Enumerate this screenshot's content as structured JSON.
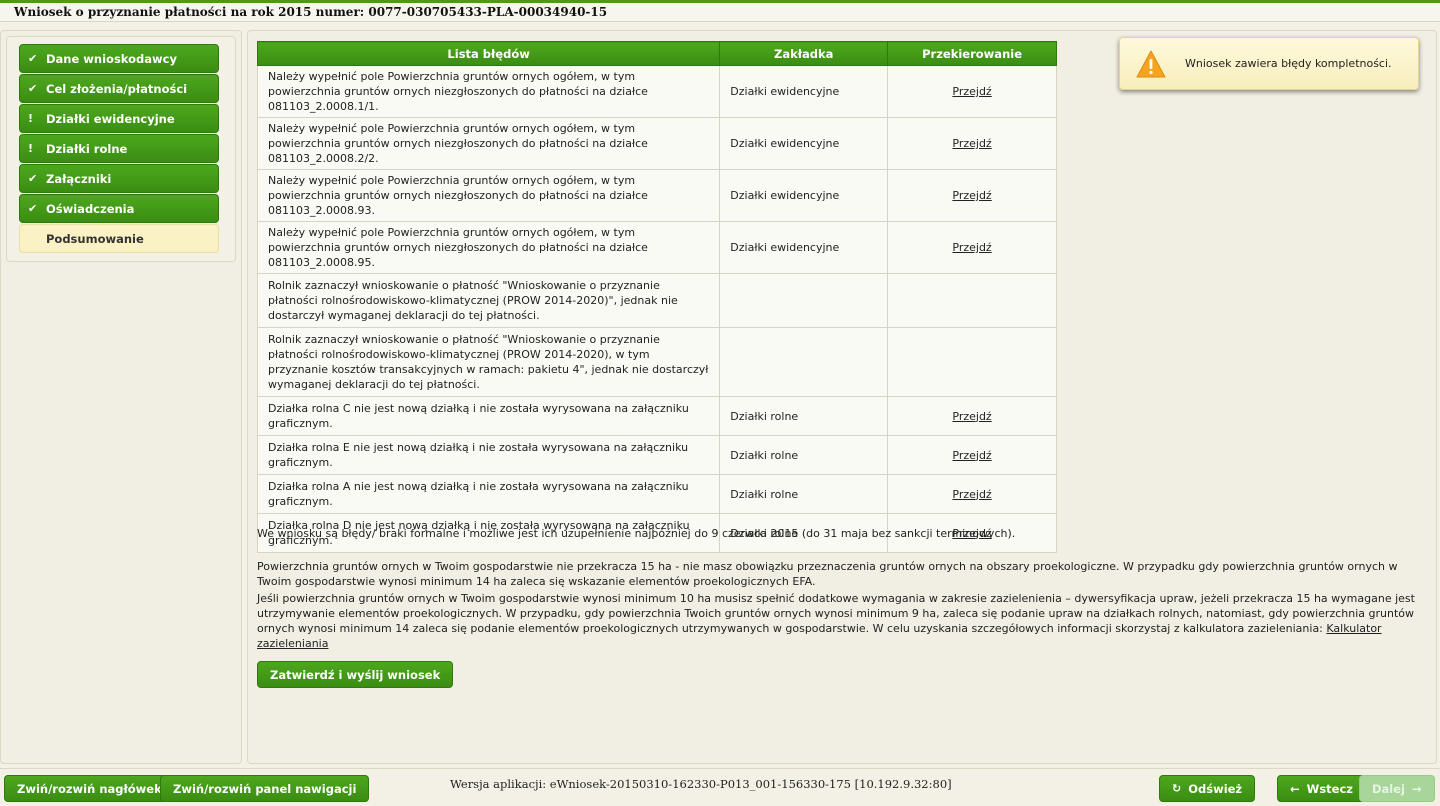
{
  "header": {
    "title": "Wniosek o przyznanie płatności na rok 2015 numer: 0077-030705433-PLA-00034940-15"
  },
  "nav": {
    "items": [
      {
        "label": "Dane wnioskodawcy",
        "icon": "✔",
        "icon_name": "check-icon"
      },
      {
        "label": "Cel złożenia/płatności",
        "icon": "✔",
        "icon_name": "check-icon"
      },
      {
        "label": "Działki ewidencyjne",
        "icon": "!",
        "icon_name": "exclamation-icon"
      },
      {
        "label": "Działki rolne",
        "icon": "!",
        "icon_name": "exclamation-icon"
      },
      {
        "label": "Załączniki",
        "icon": "✔",
        "icon_name": "check-icon"
      },
      {
        "label": "Oświadczenia",
        "icon": "✔",
        "icon_name": "check-icon"
      }
    ],
    "current": "Podsumowanie"
  },
  "table": {
    "headers": [
      "Lista błędów",
      "Zakładka",
      "Przekierowanie"
    ],
    "rows": [
      {
        "error": "Należy wypełnić pole Powierzchnia gruntów ornych ogółem, w tym powierzchnia gruntów ornych niezgłoszonych do płatności na działce 081103_2.0008.1/1.",
        "tab": "Działki ewidencyjne",
        "link": "Przejdź"
      },
      {
        "error": "Należy wypełnić pole Powierzchnia gruntów ornych ogółem, w tym powierzchnia gruntów ornych niezgłoszonych do płatności na działce 081103_2.0008.2/2.",
        "tab": "Działki ewidencyjne",
        "link": "Przejdź"
      },
      {
        "error": "Należy wypełnić pole Powierzchnia gruntów ornych ogółem, w tym powierzchnia gruntów ornych niezgłoszonych do płatności na działce 081103_2.0008.93.",
        "tab": "Działki ewidencyjne",
        "link": "Przejdź"
      },
      {
        "error": "Należy wypełnić pole Powierzchnia gruntów ornych ogółem, w tym powierzchnia gruntów ornych niezgłoszonych do płatności na działce 081103_2.0008.95.",
        "tab": "Działki ewidencyjne",
        "link": "Przejdź"
      },
      {
        "error": "Rolnik zaznaczył wnioskowanie o płatność \"Wnioskowanie o przyznanie płatności rolnośrodowiskowo-klimatycznej (PROW 2014-2020)\", jednak nie dostarczył wymaganej deklaracji do tej płatności.",
        "tab": "",
        "link": ""
      },
      {
        "error": "Rolnik zaznaczył wnioskowanie o płatność \"Wnioskowanie o przyznanie płatności rolnośrodowiskowo-klimatycznej (PROW 2014-2020), w tym przyznanie kosztów transakcyjnych w ramach: pakietu 4\", jednak nie dostarczył wymaganej deklaracji do tej płatności.",
        "tab": "",
        "link": ""
      },
      {
        "error": "Działka rolna C nie jest nową działką i nie została wyrysowana na załączniku graficznym.",
        "tab": "Działki rolne",
        "link": "Przejdź"
      },
      {
        "error": "Działka rolna E nie jest nową działką i nie została wyrysowana na załączniku graficznym.",
        "tab": "Działki rolne",
        "link": "Przejdź"
      },
      {
        "error": "Działka rolna A nie jest nową działką i nie została wyrysowana na załączniku graficznym.",
        "tab": "Działki rolne",
        "link": "Przejdź"
      },
      {
        "error": "Działka rolna D nie jest nową działką i nie została wyrysowana na załączniku graficznym.",
        "tab": "Działki rolne",
        "link": "Przejdź"
      }
    ]
  },
  "info": {
    "p1": "We wniosku są błędy/ braki formalne i możliwe jest ich uzupełnienie najpóźniej do 9 czerwca 2015 (do 31 maja bez sankcji terminowych).",
    "p2": "Powierzchnia gruntów ornych w Twoim gospodarstwie nie przekracza 15 ha - nie masz obowiązku przeznaczenia gruntów ornych na obszary proekologiczne. W przypadku gdy powierzchnia gruntów ornych w Twoim gospodarstwie wynosi minimum 14 ha zaleca się wskazanie elementów proekologicznych EFA.",
    "p3": "Jeśli powierzchnia gruntów ornych w Twoim gospodarstwie wynosi minimum 10 ha musisz spełnić dodatkowe wymagania w zakresie zazielenienia – dywersyfikacja upraw, jeżeli przekracza 15 ha wymagane jest utrzymywanie elementów proekologicznych. W przypadku, gdy powierzchnia Twoich gruntów ornych wynosi minimum 9 ha, zaleca się podanie upraw na działkach rolnych, natomiast, gdy powierzchnia gruntów ornych wynosi minimum 14 zaleca się podanie elementów proekologicznych utrzymywanych w gospodarstwie. W celu uzyskania szczegółowych informacji skorzystaj z kalkulatora zazieleniania:",
    "calc_link": "Kalkulator zazieleniania"
  },
  "submit_label": "Zatwierdź i wyślij wniosek",
  "toast": {
    "message": "Wniosek zawiera błędy kompletności."
  },
  "footer": {
    "toggle_header": "Zwiń/rozwiń nagłówek",
    "toggle_nav": "Zwiń/rozwiń panel nawigacji",
    "version": "Wersja aplikacji: eWniosek-20150310-162330-P013_001-156330-175 [10.192.9.32:80]",
    "refresh": "Odśwież",
    "back": "Wstecz",
    "next": "Dalej"
  },
  "colors": {
    "accent_green": "#3a8d12",
    "current_nav_bg": "#faf1c4",
    "toast_bg": "#fff9dc",
    "warning_orange": "#f4a41f"
  }
}
